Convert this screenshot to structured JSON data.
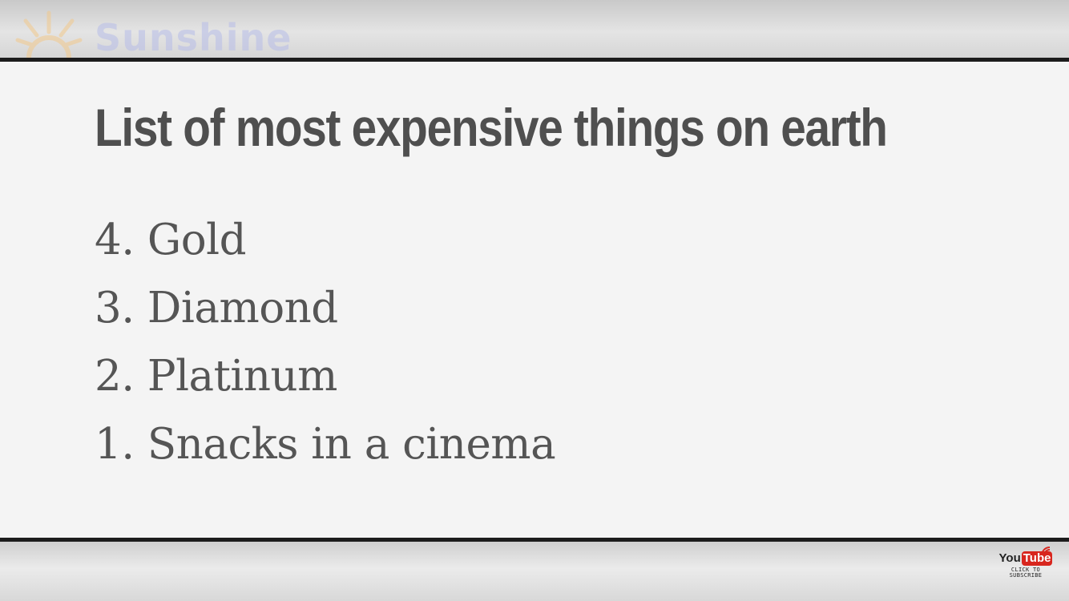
{
  "watermark": {
    "icon": "sun-icon",
    "text": "Sunshine",
    "color": "#b7bde8"
  },
  "slide": {
    "title": "List of most expensive things on earth",
    "items": [
      "4. Gold",
      "3. Diamond",
      "2. Platinum",
      "1. Snacks in a cinema"
    ]
  },
  "subscribe_badge": {
    "you": "You",
    "tube": "Tube",
    "line1": "CLICK TO",
    "line2": "SUBSCRIBE",
    "icon": "broadcast-icon",
    "accent": "#d8261e"
  }
}
